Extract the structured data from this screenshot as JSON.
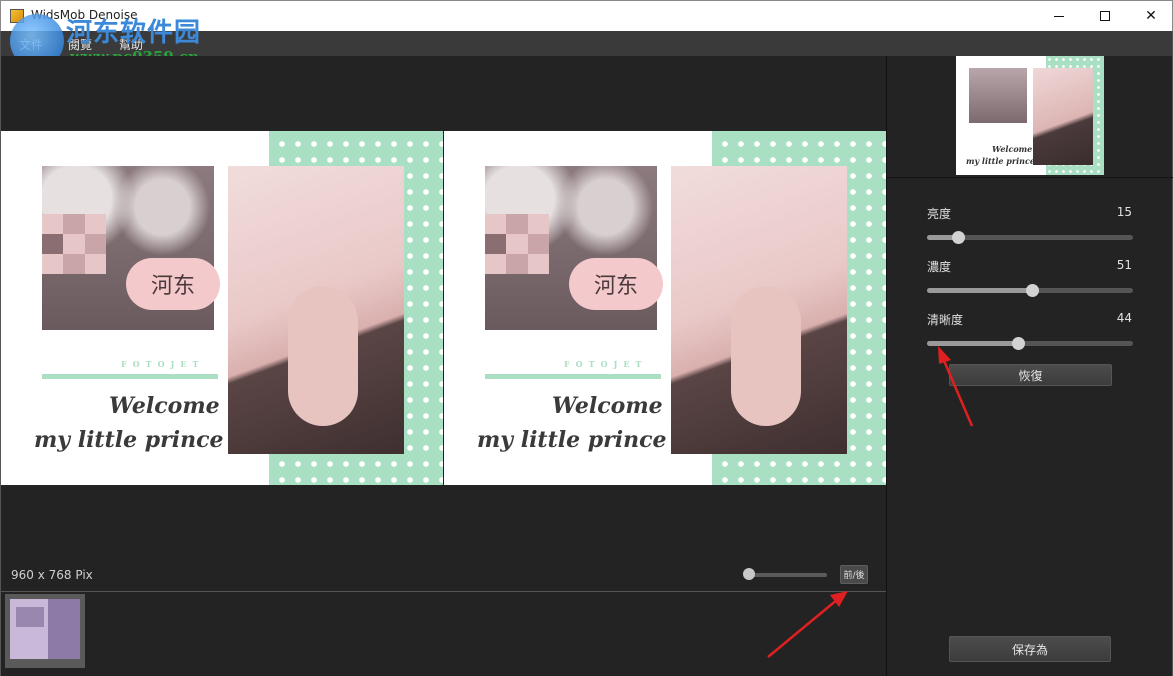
{
  "window": {
    "title": "WidsMob Denoise",
    "minimize_icon": "minimize-icon",
    "maximize_icon": "maximize-icon",
    "close_icon": "close-icon",
    "close_glyph": "✕"
  },
  "watermark": {
    "site_name": "河东软件园",
    "url": "www.pc0359.cn"
  },
  "menu": {
    "items": [
      {
        "label": "文件"
      },
      {
        "label": "閱覽"
      },
      {
        "label": "幫助"
      }
    ]
  },
  "image": {
    "cloud_text": "河东",
    "fotojet_text": "FOTOJET",
    "welcome_line": "Welcome",
    "prince_line": "my little prince"
  },
  "status": {
    "dimensions": "960 x 768 Pix",
    "before_button": "前/後"
  },
  "zoom": {
    "level": 0
  },
  "adjustments": [
    {
      "label": "亮度",
      "value": 15,
      "max": 100
    },
    {
      "label": "濃度",
      "value": 51,
      "max": 100
    },
    {
      "label": "清晰度",
      "value": 44,
      "max": 100
    }
  ],
  "buttons": {
    "reset": "恢復",
    "save_as": "保存為"
  },
  "colors": {
    "panel_bg": "#232323",
    "accent_green": "#a9dfc2",
    "arrow_red": "#e02020"
  }
}
